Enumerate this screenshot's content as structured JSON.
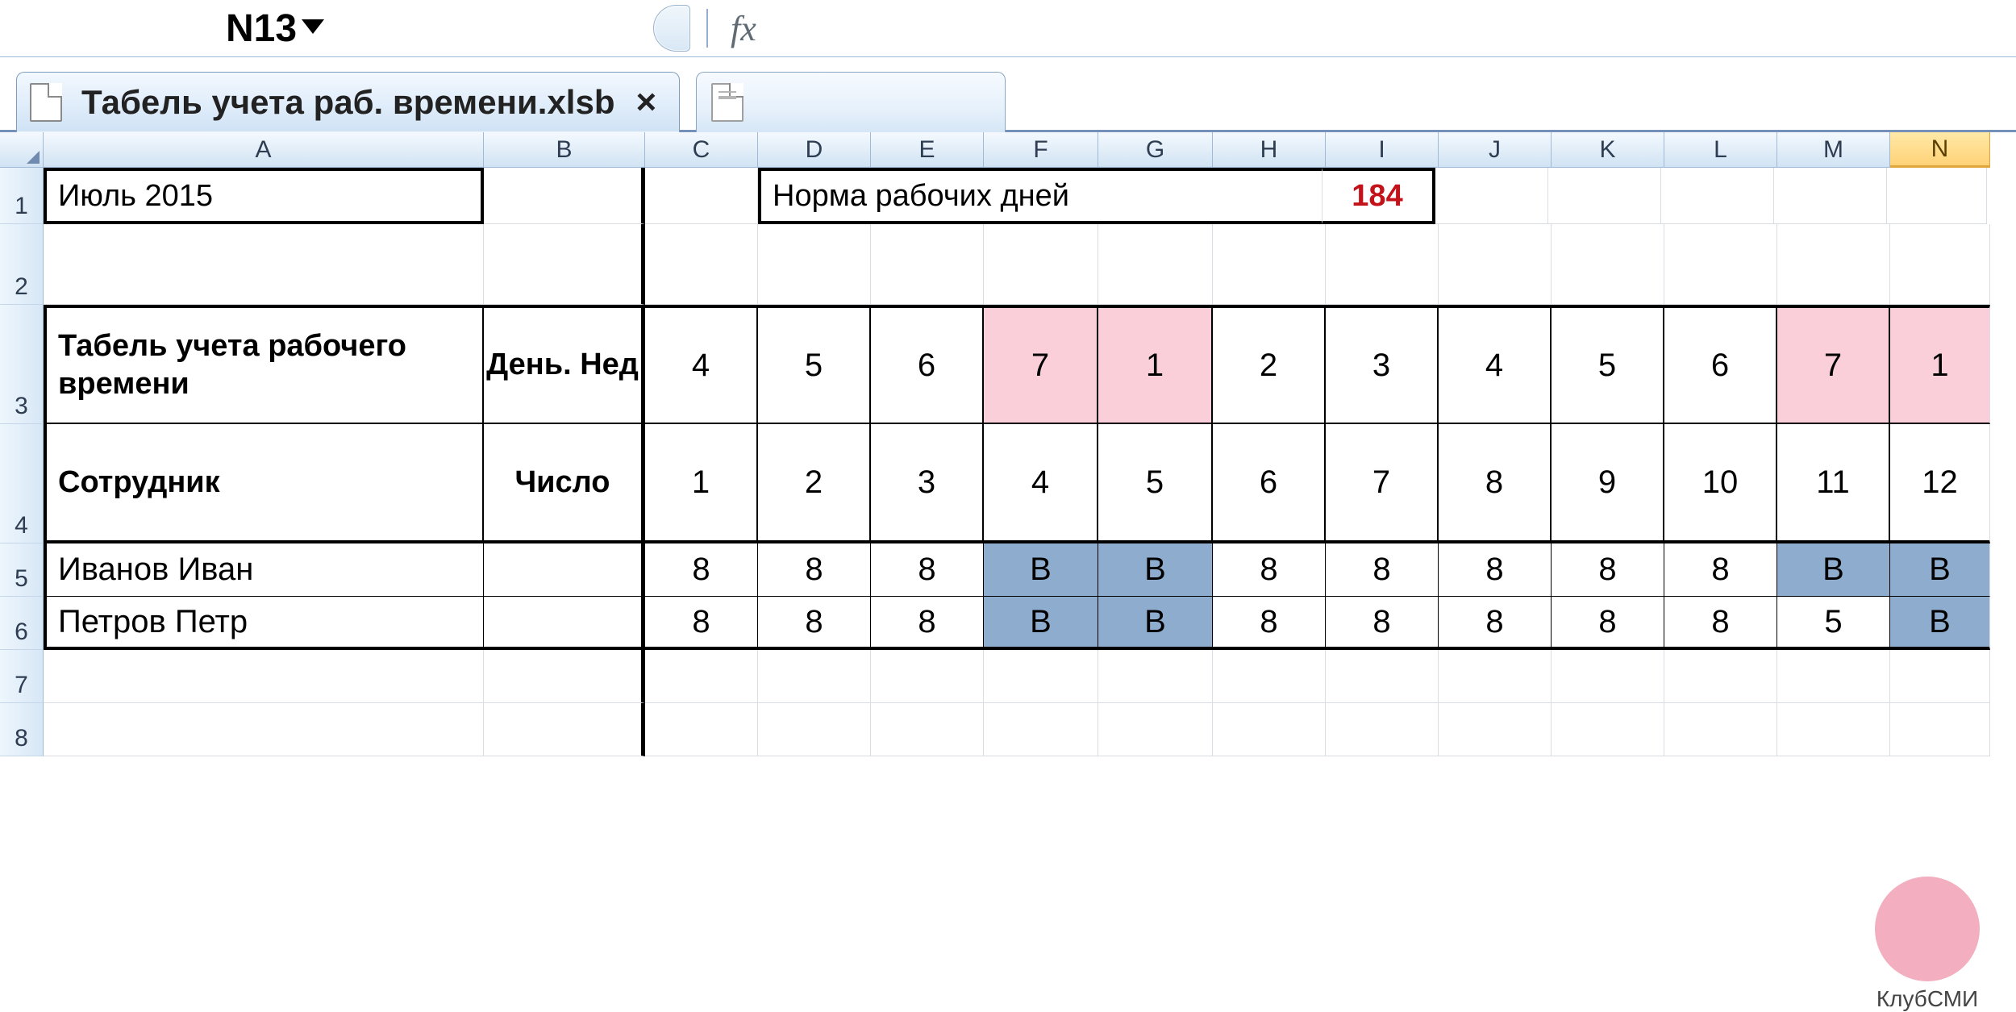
{
  "namebox": {
    "value": "N13"
  },
  "formula_bar": {
    "fx_label": "fx",
    "value": ""
  },
  "file_tabs": {
    "active_title": "Табель учета раб. времени.xlsb"
  },
  "columns": [
    "A",
    "B",
    "C",
    "D",
    "E",
    "F",
    "G",
    "H",
    "I",
    "J",
    "K",
    "L",
    "M",
    "N"
  ],
  "selected_column": "N",
  "row_headers": [
    1,
    2,
    3,
    4,
    5,
    6,
    7,
    8
  ],
  "sheet": {
    "month": "Июль 2015",
    "norm_label": "Норма рабочих дней",
    "norm_value": "184",
    "header_A": "Табель учета рабочего времени",
    "header_B": "День. Нед",
    "header2_A": "Сотрудник",
    "header2_B": "Число",
    "days_of_week": [
      "4",
      "5",
      "6",
      "7",
      "1",
      "2",
      "3",
      "4",
      "5",
      "6",
      "7",
      "1"
    ],
    "weekend_flags": [
      false,
      false,
      false,
      true,
      true,
      false,
      false,
      false,
      false,
      false,
      true,
      true
    ],
    "dates": [
      "1",
      "2",
      "3",
      "4",
      "5",
      "6",
      "7",
      "8",
      "9",
      "10",
      "11",
      "12"
    ],
    "employees": [
      {
        "name": "Иванов Иван",
        "cells": [
          "8",
          "8",
          "8",
          "В",
          "В",
          "8",
          "8",
          "8",
          "8",
          "8",
          "В",
          "В"
        ],
        "weekend": [
          false,
          false,
          false,
          true,
          true,
          false,
          false,
          false,
          false,
          false,
          true,
          true
        ]
      },
      {
        "name": "Петров Петр",
        "cells": [
          "8",
          "8",
          "8",
          "В",
          "В",
          "8",
          "8",
          "8",
          "8",
          "8",
          "5",
          "В"
        ],
        "weekend": [
          false,
          false,
          false,
          true,
          true,
          false,
          false,
          false,
          false,
          false,
          false,
          true
        ]
      }
    ]
  },
  "watermark": "КлубСМИ"
}
